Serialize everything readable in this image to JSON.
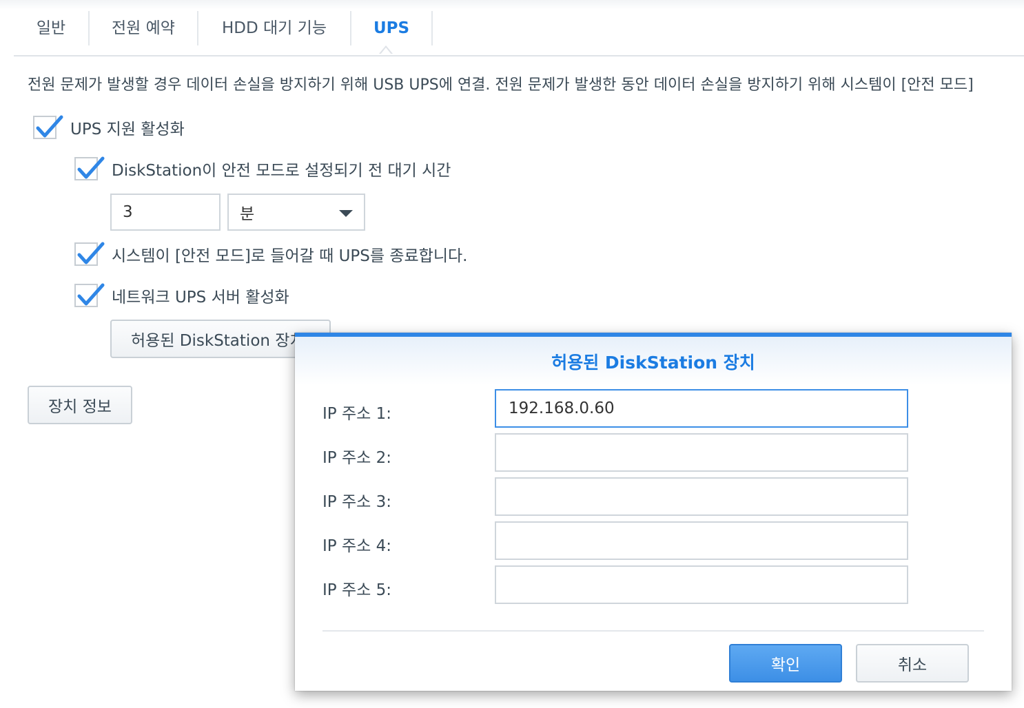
{
  "tabs": [
    {
      "label": "일반"
    },
    {
      "label": "전원 예약"
    },
    {
      "label": "HDD 대기 기능"
    },
    {
      "label": "UPS"
    }
  ],
  "description": "전원 문제가 발생할 경우 데이터 손실을 방지하기 위해 USB UPS에 연결. 전원 문제가 발생한 동안 데이터 손실을 방지하기 위해 시스템이 [안전 모드]",
  "options": {
    "enable_ups": {
      "label": "UPS 지원 활성화",
      "checked": true
    },
    "wait_time": {
      "label": "DiskStation이 안전 모드로 설정되기 전 대기 시간",
      "checked": true,
      "value": "3",
      "unit": "분"
    },
    "shutdown_ups": {
      "label": "시스템이 [안전 모드]로 들어갈 때 UPS를 종료합니다.",
      "checked": true
    },
    "network_ups": {
      "label": "네트워크 UPS 서버 활성화",
      "checked": true
    }
  },
  "buttons": {
    "allowed_devices": "허용된 DiskStation 장치",
    "device_info": "장치 정보"
  },
  "dialog": {
    "title": "허용된 DiskStation 장치",
    "fields": [
      {
        "label": "IP 주소 1:",
        "value": "192.168.0.60"
      },
      {
        "label": "IP 주소 2:",
        "value": ""
      },
      {
        "label": "IP 주소 3:",
        "value": ""
      },
      {
        "label": "IP 주소 4:",
        "value": ""
      },
      {
        "label": "IP 주소 5:",
        "value": ""
      }
    ],
    "ok_label": "확인",
    "cancel_label": "취소"
  },
  "colors": {
    "accent": "#1b7ce2",
    "check": "#2f86e6",
    "primary_button": "#3d8fe6"
  }
}
